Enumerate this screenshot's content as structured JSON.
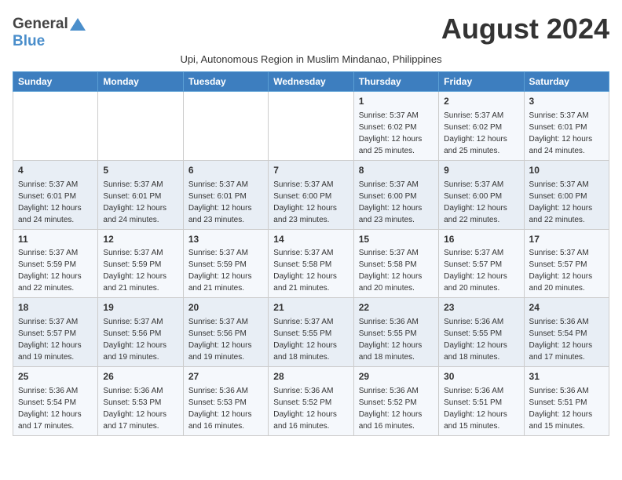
{
  "header": {
    "logo_general": "General",
    "logo_blue": "Blue",
    "month_title": "August 2024",
    "subtitle": "Upi, Autonomous Region in Muslim Mindanao, Philippines"
  },
  "days_of_week": [
    "Sunday",
    "Monday",
    "Tuesday",
    "Wednesday",
    "Thursday",
    "Friday",
    "Saturday"
  ],
  "weeks": [
    [
      {
        "day": "",
        "info": ""
      },
      {
        "day": "",
        "info": ""
      },
      {
        "day": "",
        "info": ""
      },
      {
        "day": "",
        "info": ""
      },
      {
        "day": "1",
        "info": "Sunrise: 5:37 AM\nSunset: 6:02 PM\nDaylight: 12 hours\nand 25 minutes."
      },
      {
        "day": "2",
        "info": "Sunrise: 5:37 AM\nSunset: 6:02 PM\nDaylight: 12 hours\nand 25 minutes."
      },
      {
        "day": "3",
        "info": "Sunrise: 5:37 AM\nSunset: 6:01 PM\nDaylight: 12 hours\nand 24 minutes."
      }
    ],
    [
      {
        "day": "4",
        "info": "Sunrise: 5:37 AM\nSunset: 6:01 PM\nDaylight: 12 hours\nand 24 minutes."
      },
      {
        "day": "5",
        "info": "Sunrise: 5:37 AM\nSunset: 6:01 PM\nDaylight: 12 hours\nand 24 minutes."
      },
      {
        "day": "6",
        "info": "Sunrise: 5:37 AM\nSunset: 6:01 PM\nDaylight: 12 hours\nand 23 minutes."
      },
      {
        "day": "7",
        "info": "Sunrise: 5:37 AM\nSunset: 6:00 PM\nDaylight: 12 hours\nand 23 minutes."
      },
      {
        "day": "8",
        "info": "Sunrise: 5:37 AM\nSunset: 6:00 PM\nDaylight: 12 hours\nand 23 minutes."
      },
      {
        "day": "9",
        "info": "Sunrise: 5:37 AM\nSunset: 6:00 PM\nDaylight: 12 hours\nand 22 minutes."
      },
      {
        "day": "10",
        "info": "Sunrise: 5:37 AM\nSunset: 6:00 PM\nDaylight: 12 hours\nand 22 minutes."
      }
    ],
    [
      {
        "day": "11",
        "info": "Sunrise: 5:37 AM\nSunset: 5:59 PM\nDaylight: 12 hours\nand 22 minutes."
      },
      {
        "day": "12",
        "info": "Sunrise: 5:37 AM\nSunset: 5:59 PM\nDaylight: 12 hours\nand 21 minutes."
      },
      {
        "day": "13",
        "info": "Sunrise: 5:37 AM\nSunset: 5:59 PM\nDaylight: 12 hours\nand 21 minutes."
      },
      {
        "day": "14",
        "info": "Sunrise: 5:37 AM\nSunset: 5:58 PM\nDaylight: 12 hours\nand 21 minutes."
      },
      {
        "day": "15",
        "info": "Sunrise: 5:37 AM\nSunset: 5:58 PM\nDaylight: 12 hours\nand 20 minutes."
      },
      {
        "day": "16",
        "info": "Sunrise: 5:37 AM\nSunset: 5:57 PM\nDaylight: 12 hours\nand 20 minutes."
      },
      {
        "day": "17",
        "info": "Sunrise: 5:37 AM\nSunset: 5:57 PM\nDaylight: 12 hours\nand 20 minutes."
      }
    ],
    [
      {
        "day": "18",
        "info": "Sunrise: 5:37 AM\nSunset: 5:57 PM\nDaylight: 12 hours\nand 19 minutes."
      },
      {
        "day": "19",
        "info": "Sunrise: 5:37 AM\nSunset: 5:56 PM\nDaylight: 12 hours\nand 19 minutes."
      },
      {
        "day": "20",
        "info": "Sunrise: 5:37 AM\nSunset: 5:56 PM\nDaylight: 12 hours\nand 19 minutes."
      },
      {
        "day": "21",
        "info": "Sunrise: 5:37 AM\nSunset: 5:55 PM\nDaylight: 12 hours\nand 18 minutes."
      },
      {
        "day": "22",
        "info": "Sunrise: 5:36 AM\nSunset: 5:55 PM\nDaylight: 12 hours\nand 18 minutes."
      },
      {
        "day": "23",
        "info": "Sunrise: 5:36 AM\nSunset: 5:55 PM\nDaylight: 12 hours\nand 18 minutes."
      },
      {
        "day": "24",
        "info": "Sunrise: 5:36 AM\nSunset: 5:54 PM\nDaylight: 12 hours\nand 17 minutes."
      }
    ],
    [
      {
        "day": "25",
        "info": "Sunrise: 5:36 AM\nSunset: 5:54 PM\nDaylight: 12 hours\nand 17 minutes."
      },
      {
        "day": "26",
        "info": "Sunrise: 5:36 AM\nSunset: 5:53 PM\nDaylight: 12 hours\nand 17 minutes."
      },
      {
        "day": "27",
        "info": "Sunrise: 5:36 AM\nSunset: 5:53 PM\nDaylight: 12 hours\nand 16 minutes."
      },
      {
        "day": "28",
        "info": "Sunrise: 5:36 AM\nSunset: 5:52 PM\nDaylight: 12 hours\nand 16 minutes."
      },
      {
        "day": "29",
        "info": "Sunrise: 5:36 AM\nSunset: 5:52 PM\nDaylight: 12 hours\nand 16 minutes."
      },
      {
        "day": "30",
        "info": "Sunrise: 5:36 AM\nSunset: 5:51 PM\nDaylight: 12 hours\nand 15 minutes."
      },
      {
        "day": "31",
        "info": "Sunrise: 5:36 AM\nSunset: 5:51 PM\nDaylight: 12 hours\nand 15 minutes."
      }
    ]
  ]
}
